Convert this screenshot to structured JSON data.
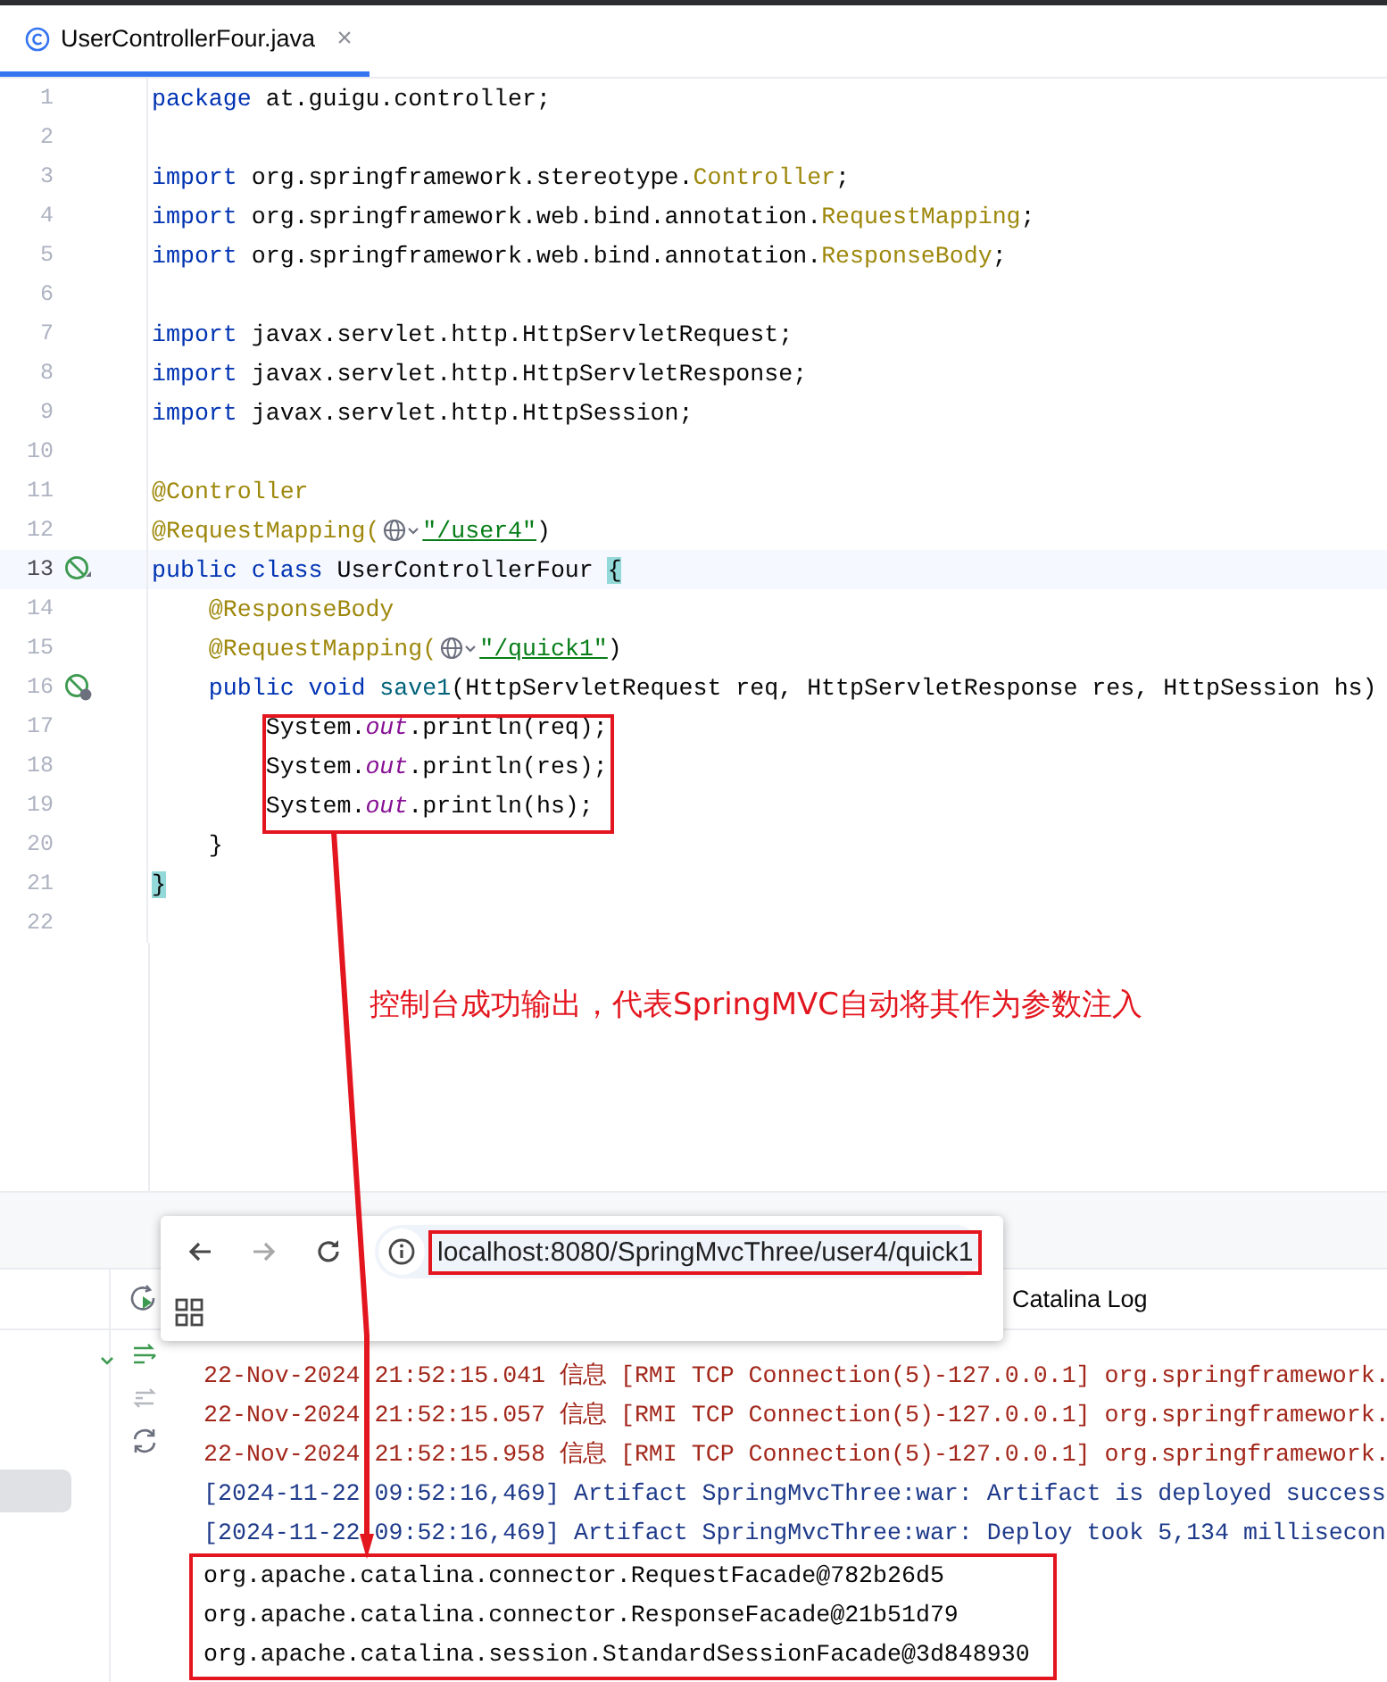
{
  "editor_tabs": [
    {
      "label": "UserControllerFour.java",
      "selected": true,
      "close": "×"
    }
  ],
  "code": {
    "lines": [
      {
        "number": "1",
        "current": false,
        "tokens": [
          {
            "kind": "kw",
            "text": "package"
          },
          {
            "kind": "plain",
            "text": " at.guigu.controller;"
          }
        ]
      },
      {
        "number": "2",
        "current": false
      },
      {
        "number": "3",
        "current": false,
        "tokens": [
          {
            "kind": "kw",
            "text": "import"
          },
          {
            "kind": "plain",
            "text": " org.springframework.stereotype."
          },
          {
            "kind": "ann",
            "text": "Controller"
          },
          {
            "kind": "plain",
            "text": ";"
          }
        ]
      },
      {
        "number": "4",
        "current": false,
        "tokens": [
          {
            "kind": "kw",
            "text": "import"
          },
          {
            "kind": "plain",
            "text": " org.springframework.web.bind.annotation."
          },
          {
            "kind": "ann",
            "text": "RequestMapping"
          },
          {
            "kind": "plain",
            "text": ";"
          }
        ]
      },
      {
        "number": "5",
        "current": false,
        "tokens": [
          {
            "kind": "kw",
            "text": "import"
          },
          {
            "kind": "plain",
            "text": " org.springframework.web.bind.annotation."
          },
          {
            "kind": "ann",
            "text": "ResponseBody"
          },
          {
            "kind": "plain",
            "text": ";"
          }
        ]
      },
      {
        "number": "6",
        "current": false
      },
      {
        "number": "7",
        "current": false,
        "tokens": [
          {
            "kind": "kw",
            "text": "import"
          },
          {
            "kind": "plain",
            "text": " javax.servlet.http.HttpServletRequest;"
          }
        ]
      },
      {
        "number": "8",
        "current": false,
        "tokens": [
          {
            "kind": "kw",
            "text": "import"
          },
          {
            "kind": "plain",
            "text": " javax.servlet.http.HttpServletResponse;"
          }
        ]
      },
      {
        "number": "9",
        "current": false,
        "tokens": [
          {
            "kind": "kw",
            "text": "import"
          },
          {
            "kind": "plain",
            "text": " javax.servlet.http.HttpSession;"
          }
        ]
      },
      {
        "number": "10",
        "current": false
      },
      {
        "number": "11",
        "current": false,
        "tokens": [
          {
            "kind": "ann",
            "text": "@Controller"
          }
        ]
      },
      {
        "number": "12",
        "current": false,
        "tokens": [
          {
            "kind": "ann",
            "text": "@RequestMapping("
          },
          {
            "kind": "globe"
          },
          {
            "kind": "str",
            "text": "\"/user4\""
          },
          {
            "kind": "plain",
            "text": ")"
          }
        ]
      },
      {
        "number": "13",
        "current": true,
        "gutter": {
          "kind": "bean"
        },
        "tokens": [
          {
            "kind": "kw",
            "text": "public"
          },
          {
            "kind": "kw",
            "text": " class"
          },
          {
            "kind": "plain",
            "text": " UserControllerFour "
          },
          {
            "kind": "brace",
            "text": "{"
          }
        ]
      },
      {
        "number": "14",
        "current": false,
        "tokens": [
          {
            "kind": "ann",
            "text": "    @ResponseBody"
          }
        ]
      },
      {
        "number": "15",
        "current": false,
        "tokens": [
          {
            "kind": "ann",
            "text": "    @RequestMapping("
          },
          {
            "kind": "globe"
          },
          {
            "kind": "str",
            "text": "\"/quick1\""
          },
          {
            "kind": "plain",
            "text": ")"
          }
        ]
      },
      {
        "number": "16",
        "current": false,
        "gutter": {
          "kind": "bean-web"
        },
        "tokens": [
          {
            "kind": "kw",
            "text": "    public"
          },
          {
            "kind": "kw",
            "text": " void"
          },
          {
            "kind": "fn",
            "text": " save1"
          },
          {
            "kind": "plain",
            "text": "(HttpServletRequest req, HttpServletResponse res, HttpSession hs)"
          }
        ]
      },
      {
        "number": "17",
        "current": false,
        "tokens": [
          {
            "kind": "plain",
            "text": "        System."
          },
          {
            "kind": "static",
            "text": "out"
          },
          {
            "kind": "plain",
            "text": ".println(req);"
          }
        ]
      },
      {
        "number": "18",
        "current": false,
        "tokens": [
          {
            "kind": "plain",
            "text": "        System."
          },
          {
            "kind": "static",
            "text": "out"
          },
          {
            "kind": "plain",
            "text": ".println(res);"
          }
        ]
      },
      {
        "number": "19",
        "current": false,
        "tokens": [
          {
            "kind": "plain",
            "text": "        System."
          },
          {
            "kind": "static",
            "text": "out"
          },
          {
            "kind": "plain",
            "text": ".println(hs);"
          }
        ]
      },
      {
        "number": "20",
        "current": false,
        "tokens": [
          {
            "kind": "plain",
            "text": "    }"
          }
        ]
      },
      {
        "number": "21",
        "current": false,
        "tokens": [
          {
            "kind": "brace",
            "text": "}"
          }
        ]
      },
      {
        "number": "22",
        "current": false
      }
    ]
  },
  "annotation": {
    "text": "控制台成功输出，代表SpringMVC自动将其作为参数注入"
  },
  "browser_popup": {
    "url": "localhost:8080/SpringMvcThree/user4/quick1"
  },
  "tool_window": {
    "tab": "Catalina Log",
    "console": [
      {
        "kind": "log",
        "text": "22-Nov-2024 21:52:15.041 信息 [RMI TCP Connection(5)-127.0.0.1] org.springframework."
      },
      {
        "kind": "log",
        "text": "22-Nov-2024 21:52:15.057 信息 [RMI TCP Connection(5)-127.0.0.1] org.springframework."
      },
      {
        "kind": "log",
        "text": "22-Nov-2024 21:52:15.958 信息 [RMI TCP Connection(5)-127.0.0.1] org.springframework."
      },
      {
        "kind": "artifact",
        "text": "[2024-11-22 09:52:16,469] Artifact SpringMvcThree:war: Artifact is deployed success"
      },
      {
        "kind": "artifact",
        "text": "[2024-11-22 09:52:16,469] Artifact SpringMvcThree:war: Deploy took 5,134 millisecon"
      },
      {
        "kind": "output",
        "text": "org.apache.catalina.connector.RequestFacade@782b26d5"
      },
      {
        "kind": "output",
        "text": "org.apache.catalina.connector.ResponseFacade@21b51d79"
      },
      {
        "kind": "output",
        "text": "org.apache.catalina.session.StandardSessionFacade@3d848930"
      }
    ]
  }
}
